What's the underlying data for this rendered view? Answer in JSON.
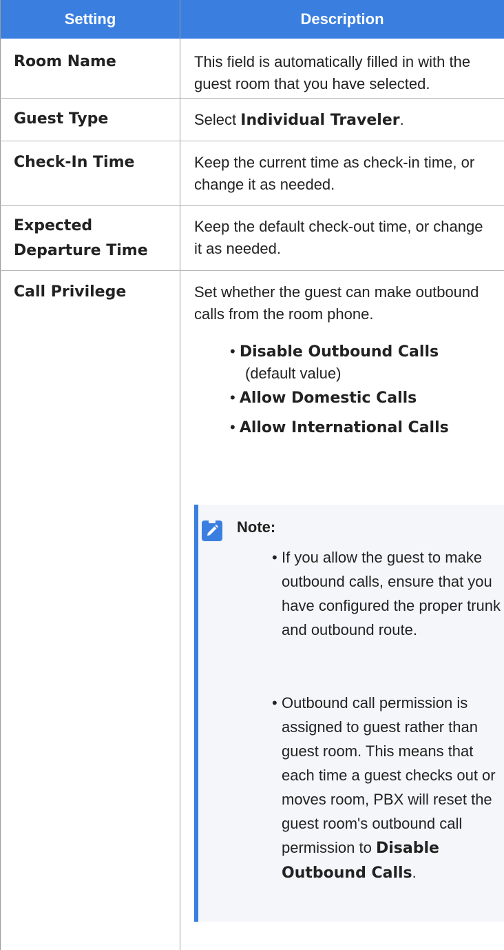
{
  "header": {
    "setting": "Setting",
    "description": "Description"
  },
  "rows": [
    {
      "setting": "Room Name",
      "description": "This field is automatically filled in with the guest room that you have selected."
    },
    {
      "setting": "Guest Type",
      "description_prefix": "Select ",
      "description_bold": "Individual Traveler",
      "description_suffix": "."
    },
    {
      "setting": "Check-In Time",
      "description": "Keep the current time as check-in time, or change it as needed."
    },
    {
      "setting_line1": "Expected",
      "setting_line2": "Departure Time",
      "description": "Keep the default check-out time, or change it as needed."
    },
    {
      "setting": "Call Privilege",
      "description": "Set whether the guest can make outbound calls from the room phone.",
      "options": [
        {
          "label": "Disable Outbound Calls",
          "suffix": "(default value)"
        },
        {
          "label": "Allow Domestic Calls"
        },
        {
          "label": "Allow International Calls"
        }
      ],
      "note": {
        "icon": "edit-icon",
        "title": "Note:",
        "bullet1": "If you allow the guest to make outbound calls, ensure that you have configured the proper trunk and outbound route.",
        "bullet2_text": "Outbound call permission is assigned to guest rather than guest room. This means that each time a guest checks out or moves room, PBX will reset the guest room's outbound call permission to",
        "bullet2_bold": "Disable Outbound Calls",
        "bullet2_end": "."
      }
    }
  ],
  "colors": {
    "header_bg": "#3a7fe0",
    "note_bg": "#f4f6f9",
    "note_border": "#3a7fe0"
  }
}
